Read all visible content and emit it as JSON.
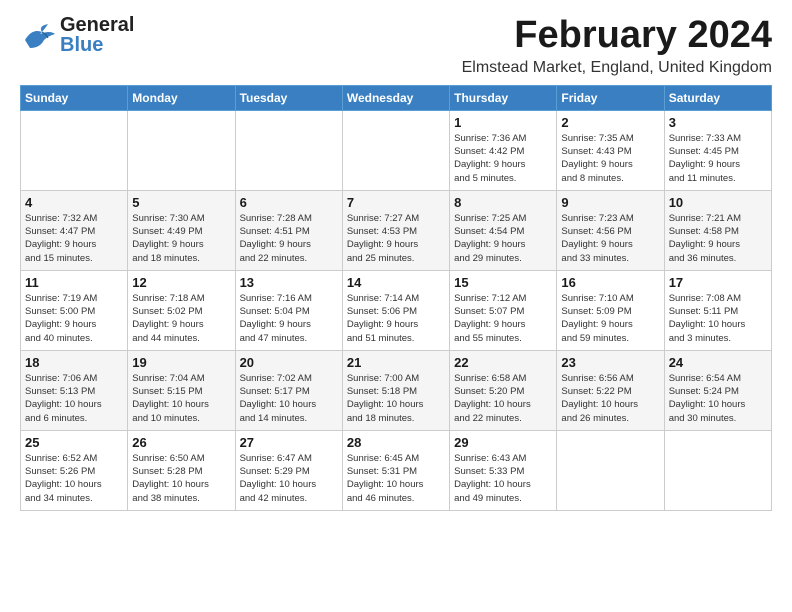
{
  "header": {
    "logo_general": "General",
    "logo_blue": "Blue",
    "title": "February 2024",
    "subtitle": "Elmstead Market, England, United Kingdom"
  },
  "days_of_week": [
    "Sunday",
    "Monday",
    "Tuesday",
    "Wednesday",
    "Thursday",
    "Friday",
    "Saturday"
  ],
  "weeks": [
    [
      {
        "day": "",
        "info": ""
      },
      {
        "day": "",
        "info": ""
      },
      {
        "day": "",
        "info": ""
      },
      {
        "day": "",
        "info": ""
      },
      {
        "day": "1",
        "info": "Sunrise: 7:36 AM\nSunset: 4:42 PM\nDaylight: 9 hours\nand 5 minutes."
      },
      {
        "day": "2",
        "info": "Sunrise: 7:35 AM\nSunset: 4:43 PM\nDaylight: 9 hours\nand 8 minutes."
      },
      {
        "day": "3",
        "info": "Sunrise: 7:33 AM\nSunset: 4:45 PM\nDaylight: 9 hours\nand 11 minutes."
      }
    ],
    [
      {
        "day": "4",
        "info": "Sunrise: 7:32 AM\nSunset: 4:47 PM\nDaylight: 9 hours\nand 15 minutes."
      },
      {
        "day": "5",
        "info": "Sunrise: 7:30 AM\nSunset: 4:49 PM\nDaylight: 9 hours\nand 18 minutes."
      },
      {
        "day": "6",
        "info": "Sunrise: 7:28 AM\nSunset: 4:51 PM\nDaylight: 9 hours\nand 22 minutes."
      },
      {
        "day": "7",
        "info": "Sunrise: 7:27 AM\nSunset: 4:53 PM\nDaylight: 9 hours\nand 25 minutes."
      },
      {
        "day": "8",
        "info": "Sunrise: 7:25 AM\nSunset: 4:54 PM\nDaylight: 9 hours\nand 29 minutes."
      },
      {
        "day": "9",
        "info": "Sunrise: 7:23 AM\nSunset: 4:56 PM\nDaylight: 9 hours\nand 33 minutes."
      },
      {
        "day": "10",
        "info": "Sunrise: 7:21 AM\nSunset: 4:58 PM\nDaylight: 9 hours\nand 36 minutes."
      }
    ],
    [
      {
        "day": "11",
        "info": "Sunrise: 7:19 AM\nSunset: 5:00 PM\nDaylight: 9 hours\nand 40 minutes."
      },
      {
        "day": "12",
        "info": "Sunrise: 7:18 AM\nSunset: 5:02 PM\nDaylight: 9 hours\nand 44 minutes."
      },
      {
        "day": "13",
        "info": "Sunrise: 7:16 AM\nSunset: 5:04 PM\nDaylight: 9 hours\nand 47 minutes."
      },
      {
        "day": "14",
        "info": "Sunrise: 7:14 AM\nSunset: 5:06 PM\nDaylight: 9 hours\nand 51 minutes."
      },
      {
        "day": "15",
        "info": "Sunrise: 7:12 AM\nSunset: 5:07 PM\nDaylight: 9 hours\nand 55 minutes."
      },
      {
        "day": "16",
        "info": "Sunrise: 7:10 AM\nSunset: 5:09 PM\nDaylight: 9 hours\nand 59 minutes."
      },
      {
        "day": "17",
        "info": "Sunrise: 7:08 AM\nSunset: 5:11 PM\nDaylight: 10 hours\nand 3 minutes."
      }
    ],
    [
      {
        "day": "18",
        "info": "Sunrise: 7:06 AM\nSunset: 5:13 PM\nDaylight: 10 hours\nand 6 minutes."
      },
      {
        "day": "19",
        "info": "Sunrise: 7:04 AM\nSunset: 5:15 PM\nDaylight: 10 hours\nand 10 minutes."
      },
      {
        "day": "20",
        "info": "Sunrise: 7:02 AM\nSunset: 5:17 PM\nDaylight: 10 hours\nand 14 minutes."
      },
      {
        "day": "21",
        "info": "Sunrise: 7:00 AM\nSunset: 5:18 PM\nDaylight: 10 hours\nand 18 minutes."
      },
      {
        "day": "22",
        "info": "Sunrise: 6:58 AM\nSunset: 5:20 PM\nDaylight: 10 hours\nand 22 minutes."
      },
      {
        "day": "23",
        "info": "Sunrise: 6:56 AM\nSunset: 5:22 PM\nDaylight: 10 hours\nand 26 minutes."
      },
      {
        "day": "24",
        "info": "Sunrise: 6:54 AM\nSunset: 5:24 PM\nDaylight: 10 hours\nand 30 minutes."
      }
    ],
    [
      {
        "day": "25",
        "info": "Sunrise: 6:52 AM\nSunset: 5:26 PM\nDaylight: 10 hours\nand 34 minutes."
      },
      {
        "day": "26",
        "info": "Sunrise: 6:50 AM\nSunset: 5:28 PM\nDaylight: 10 hours\nand 38 minutes."
      },
      {
        "day": "27",
        "info": "Sunrise: 6:47 AM\nSunset: 5:29 PM\nDaylight: 10 hours\nand 42 minutes."
      },
      {
        "day": "28",
        "info": "Sunrise: 6:45 AM\nSunset: 5:31 PM\nDaylight: 10 hours\nand 46 minutes."
      },
      {
        "day": "29",
        "info": "Sunrise: 6:43 AM\nSunset: 5:33 PM\nDaylight: 10 hours\nand 49 minutes."
      },
      {
        "day": "",
        "info": ""
      },
      {
        "day": "",
        "info": ""
      }
    ]
  ]
}
